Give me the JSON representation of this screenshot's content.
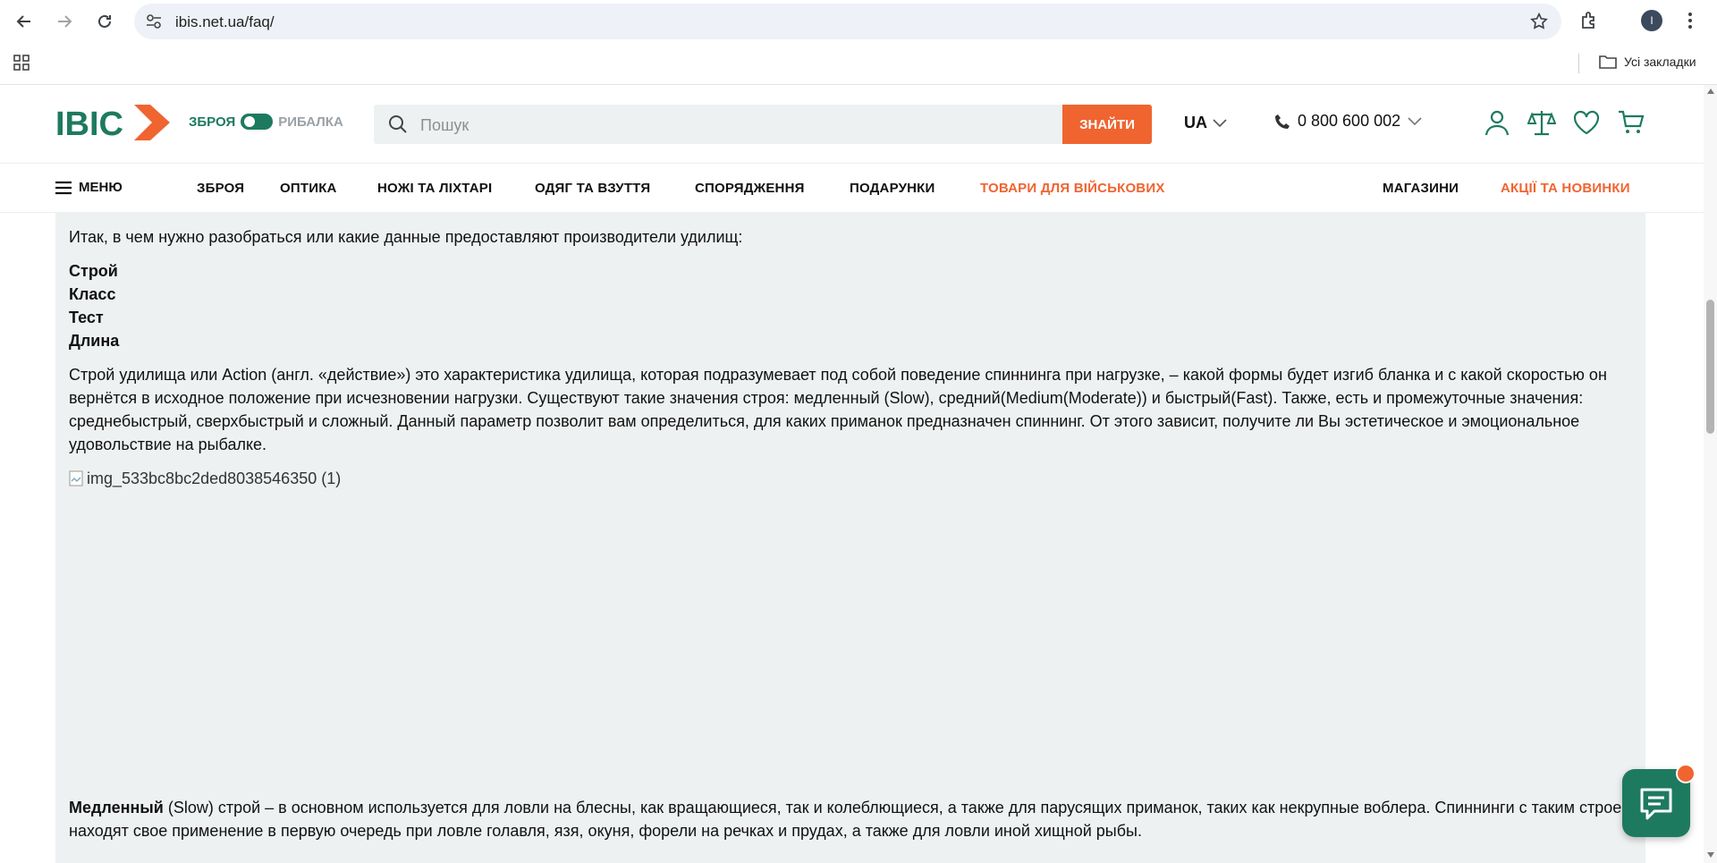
{
  "browser": {
    "url": "ibis.net.ua/faq/",
    "bookmarks_all": "Усі закладки",
    "profile_initial": "I"
  },
  "header": {
    "logo_text": "IBIC",
    "toggle_left": "ЗБРОЯ",
    "toggle_right": "РИБАЛКА",
    "search_placeholder": "Пошук",
    "search_button": "ЗНАЙТИ",
    "lang": "UA",
    "phone": "0 800 600 002"
  },
  "menu": {
    "burger_label": "МЕНЮ",
    "items": [
      {
        "label": "ЗБРОЯ"
      },
      {
        "label": "ОПТИКА"
      },
      {
        "label": "НОЖІ ТА ЛІХТАРІ"
      },
      {
        "label": "ОДЯГ ТА ВЗУТТЯ"
      },
      {
        "label": "СПОРЯДЖЕННЯ"
      },
      {
        "label": "ПОДАРУНКИ"
      },
      {
        "label": "ТОВАРИ ДЛЯ ВІЙСЬКОВИХ"
      }
    ],
    "right_items": [
      {
        "label": "МАГАЗИНИ"
      },
      {
        "label": "АКЦІЇ ТА НОВИНКИ"
      }
    ]
  },
  "article": {
    "intro": "Итак, в чем нужно разобраться или какие данные предоставляют производители удилищ:",
    "list": [
      "Строй",
      "Класс",
      "Тест",
      "Длина"
    ],
    "paragraph1": "Строй удилища или Action (англ.  «действие») это характеристика удилища, которая подразумевает под собой поведение спиннинга при нагрузке, – какой формы будет изгиб бланка и с какой скоростью он вернётся в исходное положение при исчезновении нагрузки. Существуют такие значения строя: медленный (Slow), средний(Medium(Moderate)) и быстрый(Fast). Также, есть и промежуточные значения: среднебыстрый, сверхбыстрый и сложный.  Данный параметр позволит вам определиться, для каких приманок предназначен спиннинг. От этого зависит, получите ли Вы эстетическое и эмоциональное удовольствие на рыбалке.",
    "image_alt": "img_533bc8bc2ded8038546350 (1)",
    "p2_bold": "Медленный",
    "p2_rest": " (Slow) строй – в основном используется для ловли на блесны, как вращающиеся, так и колеблющиеся, а также для парусящих приманок, таких как некрупные воблера. Спиннинги с таким строем находят свое применение в первую очередь при ловле голавля, язя, окуня, форели на речках и прудах, а также для ловли иной хищной рыбы."
  },
  "colors": {
    "brand_green": "#1e7a5f",
    "accent_orange": "#f06430",
    "content_bg": "#eef1f1"
  }
}
